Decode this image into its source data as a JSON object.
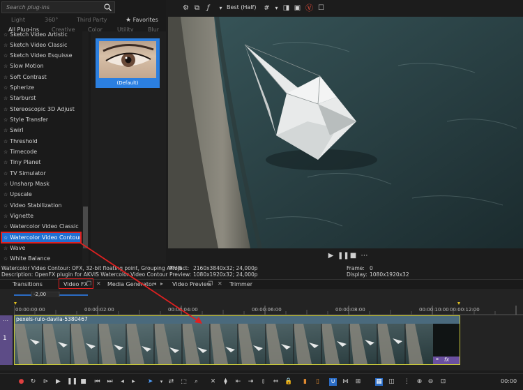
{
  "search": {
    "placeholder": "Search plug-ins"
  },
  "tabs_row1": [
    "Light",
    "360°",
    "Third Party",
    "Favorites"
  ],
  "tabs_row2": [
    "All Plug-ins",
    "Creative",
    "Color",
    "Utility",
    "Blur"
  ],
  "plugin_list": [
    "Sketch Video Artistic",
    "Sketch Video Classic",
    "Sketch Video Esquisse",
    "Slow Motion",
    "Soft Contrast",
    "Spherize",
    "Starburst",
    "Stereoscopic 3D Adjust",
    "Style Transfer",
    "Swirl",
    "Threshold",
    "Timecode",
    "Tiny Planet",
    "TV Simulator",
    "Unsharp Mask",
    "Upscale",
    "Video Stabilization",
    "Vignette",
    "Watercolor Video Classic",
    "Watercolor Video Contour",
    "Wave",
    "White Balance"
  ],
  "selected_plugin": "Watercolor Video Contour",
  "preset": {
    "label": "(Default)"
  },
  "viewer": {
    "quality": "Best (Half)"
  },
  "info": {
    "line1": "Watercolor Video Contour: OFX, 32-bit floating point, Grouping AKVIS",
    "line2": "Description: OpenFX plugin for AKVIS Watercolor Video Contour",
    "project_label": "Project:",
    "project_value": "2160x3840x32; 24,000p",
    "preview_label": "Preview:",
    "preview_value": "1080x1920x32; 24,000p",
    "frame_label": "Frame:",
    "frame_value": "0",
    "display_label": "Display:",
    "display_value": "1080x1920x32"
  },
  "window_tabs": [
    "Transitions",
    "Video FX",
    "Media Generator",
    "Video Preview",
    "Trimmer"
  ],
  "timeline": {
    "rate_label": "-2,00",
    "ticks": [
      "00:00:00:00",
      "00:00:02:00",
      "00:00:04:00",
      "00:00:06:00",
      "00:00:08:00",
      "00:00:10:00",
      "00:00:12:00"
    ],
    "track_number": "1",
    "clip_name": "pexels-rulo-davila-5380467",
    "clip_fx": "fx"
  },
  "bottom": {
    "timecode": "00:00"
  },
  "colors": {
    "accent_blue": "#1f6fd1",
    "highlight_red": "#e02020",
    "clip_border": "#c9c93a",
    "track_header": "#5d4c87"
  }
}
